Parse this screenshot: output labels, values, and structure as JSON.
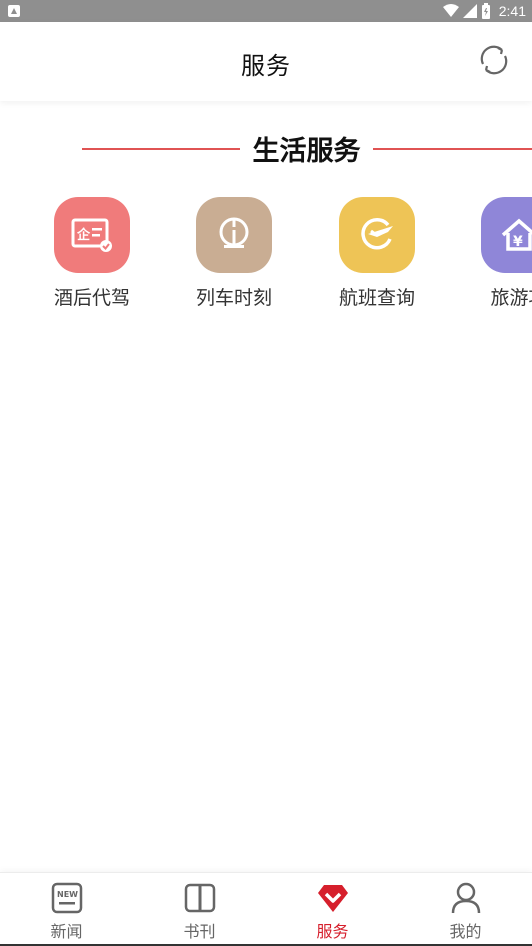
{
  "status_bar": {
    "time": "2:41"
  },
  "header": {
    "title": "服务"
  },
  "section": {
    "title": "生活服务"
  },
  "services": [
    {
      "label": "酒后代驾",
      "icon": "designated-driver-icon",
      "color": "#f07b7b"
    },
    {
      "label": "列车时刻",
      "icon": "train-schedule-icon",
      "color": "#c9ad93"
    },
    {
      "label": "航班查询",
      "icon": "flight-query-icon",
      "color": "#eec456"
    },
    {
      "label": "旅游攻",
      "icon": "travel-guide-icon",
      "color": "#8f86d8"
    }
  ],
  "bottom_nav": [
    {
      "label": "新闻",
      "icon": "news-icon",
      "active": false
    },
    {
      "label": "书刊",
      "icon": "book-icon",
      "active": false
    },
    {
      "label": "服务",
      "icon": "service-icon",
      "active": true
    },
    {
      "label": "我的",
      "icon": "profile-icon",
      "active": false
    }
  ],
  "colors": {
    "accent": "#d61f2c",
    "divider": "#e05353",
    "status_bar": "#8f8f8f"
  }
}
